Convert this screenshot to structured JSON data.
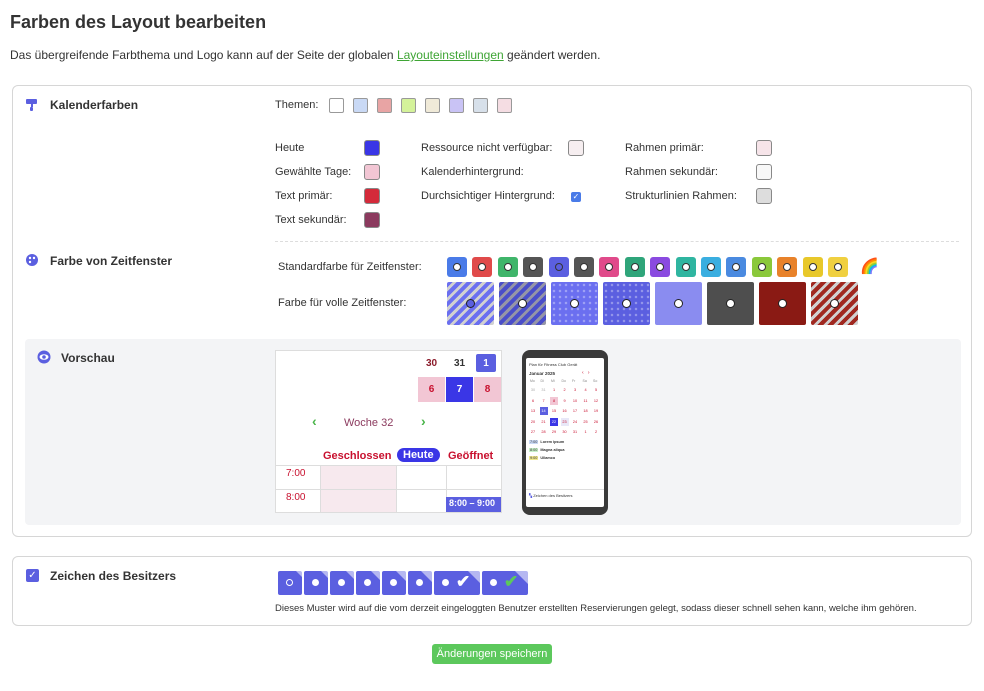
{
  "header": {
    "title": "Farben des Layout bearbeiten",
    "intro_before": "Das übergreifende Farbthema und Logo kann auf der Seite der globalen ",
    "intro_link": "Layouteinstellungen",
    "intro_after": " geändert werden."
  },
  "calendar_colors": {
    "title": "Kalenderfarben",
    "themes_label": "Themen:",
    "themes": [
      "#ffffff",
      "#c9d9f5",
      "#e8a4a4",
      "#d4f29a",
      "#f0ead8",
      "#c9c3f5",
      "#d7e0ea",
      "#f5dde3"
    ],
    "col1": [
      {
        "label": "Heute",
        "color": "#3a36e6"
      },
      {
        "label": "Gewählte Tage:",
        "color": "#f2c6d4"
      },
      {
        "label": "Text primär:",
        "color": "#d42a3a"
      },
      {
        "label": "Text sekundär:",
        "color": "#8b3a5e"
      }
    ],
    "col2": [
      {
        "label": "Ressource nicht verfügbar:",
        "color": "#f6eef0"
      },
      {
        "label": "Kalenderhintergrund:",
        "color": ""
      },
      {
        "label": "Durchsichtiger Hintergrund:",
        "checked": true
      }
    ],
    "col3": [
      {
        "label": "Rahmen primär:",
        "color": "#f6e4e9"
      },
      {
        "label": "Rahmen sekundär:",
        "color": "#f8f8f8"
      },
      {
        "label": "Strukturlinien Rahmen:",
        "color": "#dddddd"
      }
    ]
  },
  "slot_colors": {
    "title": "Farbe von Zeitfenster",
    "standard_label": "Standardfarbe für Zeitfenster:",
    "standard": [
      "#4a7be8",
      "#e04a4a",
      "#3fb56a",
      "#555555",
      "#5b5fe0",
      "#555555",
      "#e04a8a",
      "#2fa57a",
      "#8a4ae0",
      "#2fb5a0",
      "#3aaee0",
      "#4a8ae0",
      "#8ac83a",
      "#e8822a",
      "#e8c82a",
      "#f0d040"
    ],
    "rainbow_icon": "rainbow-icon",
    "full_label": "Farbe für volle Zeitfenster:",
    "full": [
      {
        "color": "#6b6ff0",
        "pattern": "stripes"
      },
      {
        "color": "#4a4ec8",
        "pattern": "stripes-dark"
      },
      {
        "color": "#6b6ff0",
        "pattern": "dots"
      },
      {
        "color": "#5b5fe0",
        "pattern": "dots"
      },
      {
        "color": "#8a8cf0",
        "pattern": "plain"
      },
      {
        "color": "#4e4e4e",
        "pattern": "plain"
      },
      {
        "color": "#8a1a14",
        "pattern": "plain"
      },
      {
        "color": "#a02820",
        "pattern": "stripes"
      }
    ]
  },
  "preview": {
    "title": "Vorschau",
    "calendar": {
      "row1": [
        "30",
        "31",
        "1"
      ],
      "row2": [
        "6",
        "7",
        "8"
      ],
      "week": "Woche 32",
      "closed": "Geschlossen",
      "today": "Heute",
      "open": "Geöffnet",
      "times": [
        "7:00",
        "8:00"
      ],
      "slot": "8:00 – 9:00"
    },
    "phone": {
      "header": "Plan für Fitness Club Gerät",
      "month": "Januar 2025",
      "weekdays": [
        "Mo",
        "Di",
        "Mi",
        "Do",
        "Fr",
        "Sa",
        "So"
      ],
      "days": [
        [
          "30",
          "31",
          "1",
          "2",
          "3",
          "4",
          "5"
        ],
        [
          "6",
          "7",
          "8",
          "9",
          "10",
          "11",
          "12"
        ],
        [
          "13",
          "14",
          "15",
          "16",
          "17",
          "18",
          "19"
        ],
        [
          "20",
          "21",
          "22",
          "23",
          "24",
          "25",
          "26"
        ],
        [
          "27",
          "28",
          "29",
          "30",
          "31",
          "1",
          "2"
        ]
      ],
      "legend": [
        {
          "time": "7:00",
          "text": "Lorem ipsum",
          "color": "#c9d9f5"
        },
        {
          "time": "8:00",
          "text": "Magna aliqua",
          "color": "#c8f0c8"
        },
        {
          "time": "9:00",
          "text": "Ullamco",
          "color": "#f0e890"
        }
      ],
      "footer": "Zeichen des Besitzers"
    }
  },
  "owner_sign": {
    "title": "Zeichen des Besitzers",
    "description": "Dieses Muster wird auf die vom derzeit eingeloggten Benutzer erstellten Reservierungen gelegt, sodass dieser schnell sehen kann, welche ihm gehören.",
    "count": 8
  },
  "save_label": "Änderungen speichern"
}
